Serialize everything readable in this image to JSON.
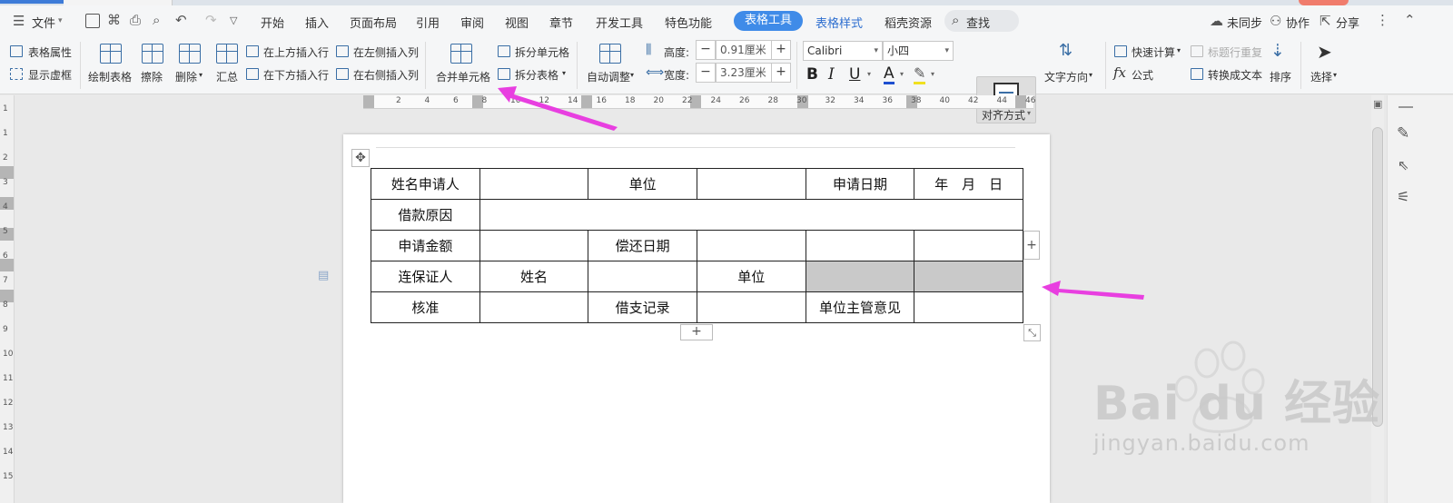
{
  "menu": {
    "file": "文件",
    "items": [
      "开始",
      "插入",
      "页面布局",
      "引用",
      "审阅",
      "视图",
      "章节",
      "开发工具",
      "特色功能"
    ],
    "active_tab": "表格工具",
    "table_style": "表格样式",
    "resources": "稻壳资源",
    "search": "查找",
    "unsync": "未同步",
    "collab": "协作",
    "share": "分享"
  },
  "ribbon": {
    "table_props": "表格属性",
    "show_grid": "显示虚框",
    "draw_table": "绘制表格",
    "erase": "擦除",
    "delete": "删除",
    "summary": "汇总",
    "insert_above": "在上方插入行",
    "insert_below": "在下方插入行",
    "insert_left": "在左侧插入列",
    "insert_right": "在右侧插入列",
    "merge_cells": "合并单元格",
    "split_cells": "拆分单元格",
    "split_table": "拆分表格",
    "auto_fit": "自动调整",
    "height_label": "高度:",
    "height_value": "0.91厘米",
    "width_label": "宽度:",
    "width_value": "3.23厘米",
    "font_name": "Calibri",
    "font_size": "小四",
    "align": "对齐方式",
    "text_direction": "文字方向",
    "quick_calc": "快速计算",
    "header_repeat": "标题行重复",
    "formula": "公式",
    "convert_text": "转换成文本",
    "sort": "排序",
    "select": "选择"
  },
  "ruler_labels": [
    "2",
    "4",
    "6",
    "8",
    "10",
    "12",
    "14",
    "16",
    "18",
    "20",
    "22",
    "24",
    "26",
    "28",
    "30",
    "32",
    "34",
    "36",
    "38",
    "40",
    "42",
    "44",
    "46"
  ],
  "v_ruler_labels": [
    "1",
    "1",
    "2",
    "3",
    "4",
    "5",
    "6",
    "7",
    "8",
    "9",
    "10",
    "11",
    "12",
    "13",
    "14",
    "15"
  ],
  "table": {
    "rows": [
      [
        {
          "t": "姓名申请人"
        },
        {
          "t": ""
        },
        {
          "t": "单位"
        },
        {
          "t": ""
        },
        {
          "t": "申请日期"
        },
        {
          "t": "年　月　日"
        }
      ],
      [
        {
          "t": "借款原因"
        },
        {
          "t": "",
          "span": 5
        }
      ],
      [
        {
          "t": "申请金额"
        },
        {
          "t": ""
        },
        {
          "t": "偿还日期"
        },
        {
          "t": ""
        },
        {
          "t": ""
        },
        {
          "t": ""
        }
      ],
      [
        {
          "t": "连保证人"
        },
        {
          "t": "姓名"
        },
        {
          "t": ""
        },
        {
          "t": "单位"
        },
        {
          "t": "",
          "hl": true
        },
        {
          "t": "",
          "hl": true
        }
      ],
      [
        {
          "t": "核准"
        },
        {
          "t": ""
        },
        {
          "t": "借支记录"
        },
        {
          "t": ""
        },
        {
          "t": "单位主管意见"
        },
        {
          "t": ""
        }
      ]
    ]
  },
  "watermark": {
    "brand": "Bai du 经验",
    "url": "jingyan.baidu.com"
  },
  "colors": {
    "accent": "#3f8be8",
    "arrow": "#e83fe0",
    "highlight": "#c9c9c9"
  }
}
